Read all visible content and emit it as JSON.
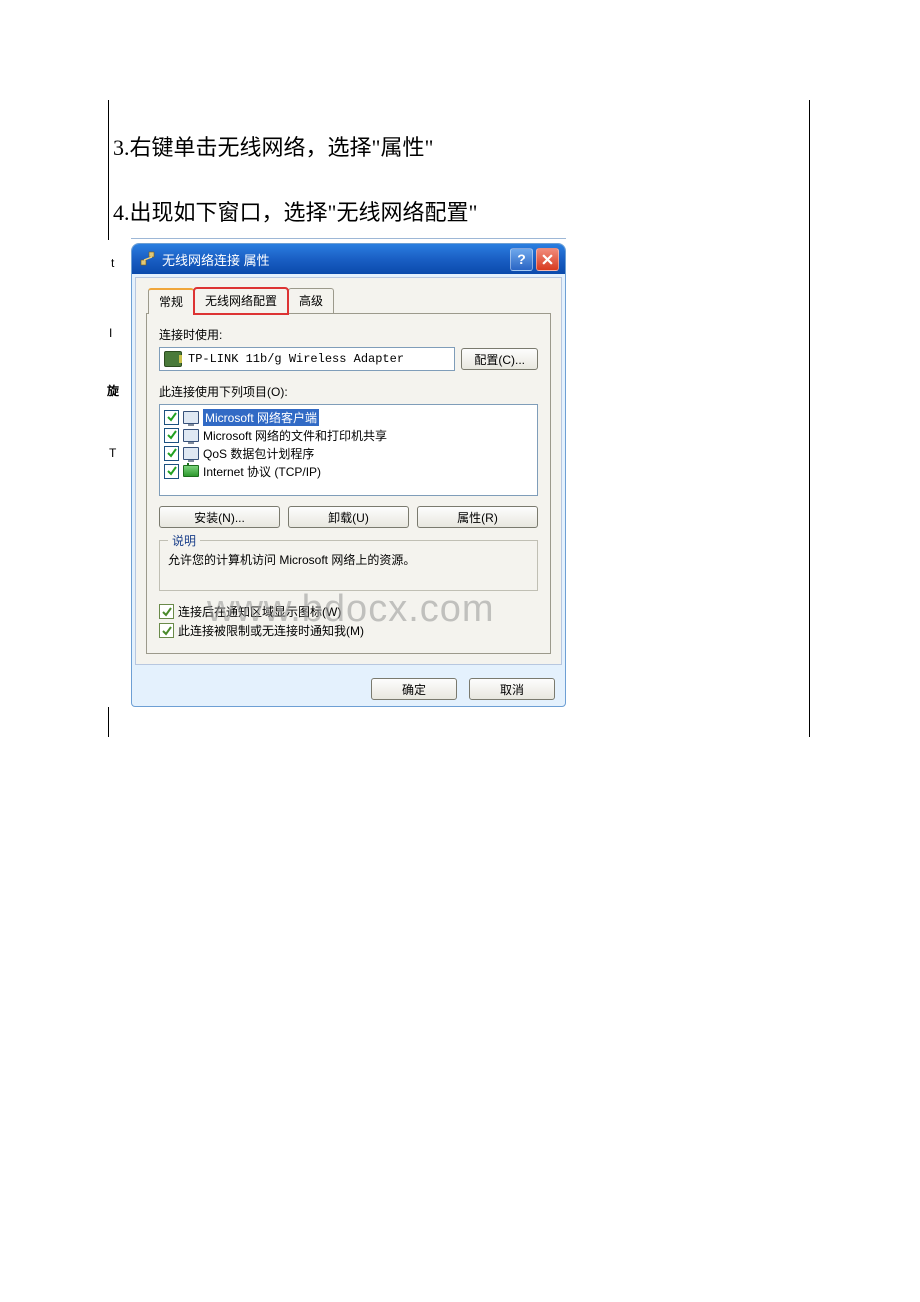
{
  "steps": {
    "s3": "3.右键单击无线网络，选择\"属性\"",
    "s4": "4.出现如下窗口，选择\"无线网络配置\""
  },
  "fragments": {
    "t": "t",
    "i": "I",
    "f": "旋",
    "t2": "T"
  },
  "dialog": {
    "title": "无线网络连接  属性",
    "tabs": {
      "general": "常规",
      "wireless": "无线网络配置",
      "advanced": "高级"
    },
    "connect_using": "连接时使用:",
    "adapter": "TP-LINK 11b/g Wireless Adapter",
    "configure_btn": "配置(C)...",
    "items_label": "此连接使用下列项目(O):",
    "items": [
      "Microsoft 网络客户端",
      "Microsoft 网络的文件和打印机共享",
      "QoS 数据包计划程序",
      "Internet 协议 (TCP/IP)"
    ],
    "install_btn": "安装(N)...",
    "uninstall_btn": "卸载(U)",
    "properties_btn": "属性(R)",
    "desc_title": "说明",
    "desc_text": "允许您的计算机访问 Microsoft 网络上的资源。",
    "show_icon": "连接后在通知区域显示图标(W)",
    "notify": "此连接被限制或无连接时通知我(M)",
    "ok": "确定",
    "cancel": "取消"
  },
  "watermark": "www.bdocx.com"
}
